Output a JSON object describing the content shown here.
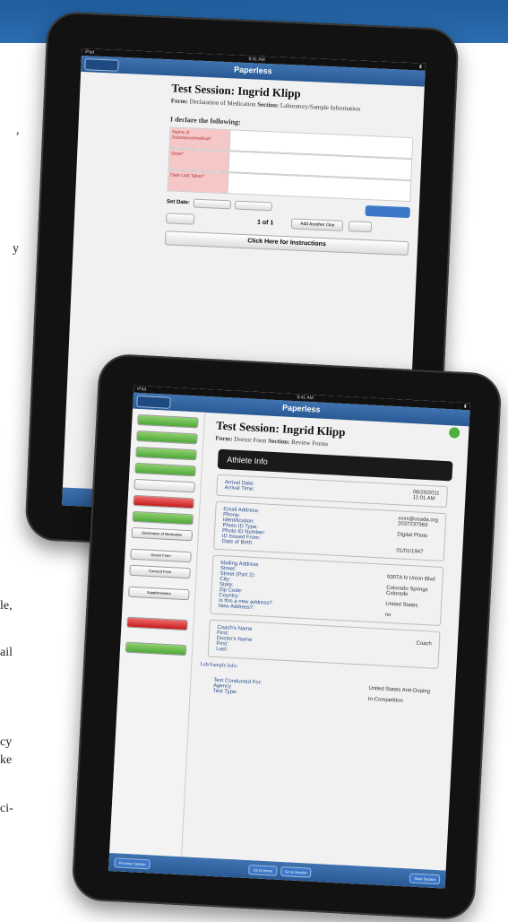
{
  "page": {
    "text_fragments": [
      ",",
      "y",
      "le,",
      "ail",
      "cy",
      "ke",
      "ci-"
    ]
  },
  "back_tablet": {
    "status_time": "9:41 AM",
    "app_title": "Paperless",
    "session_title": "Test Session: Ingrid Klipp",
    "form_label": "Form:",
    "form_name": "Declaration of Medication",
    "section_label": "Section:",
    "section_name": "Laboratory/Sample Information",
    "declare_heading": "I declare the following:",
    "field1_label": "Name of Substance/method*",
    "field2_label": "Dose*",
    "field3_label": "Date Last Taken*",
    "list_date_label": "Set Date:",
    "pager": "1 of 1",
    "add_another": "Add Another One",
    "instructions": "Click Here for Instructions"
  },
  "front_tablet": {
    "app_title": "Paperless",
    "session_title": "Test Session: Ingrid Klipp",
    "form_label": "Form:",
    "form_name": "Doctor Form",
    "section_label": "Section:",
    "section_name": "Review Forms",
    "sidebar_items": [
      "Declaration of Medication",
      "Doctor Form",
      "Consent Form",
      "Supplementary"
    ],
    "header": "Athlete Info",
    "arrival": {
      "labels": [
        "Arrival Date:",
        "Arrival Time:"
      ],
      "values": [
        "06/20/2011",
        "11:01 AM"
      ]
    },
    "identity": {
      "labels": [
        "Email Address:",
        "Phone:",
        "Identification:",
        "Photo ID Type:",
        "Photo ID Number:",
        "ID Issued From:",
        "Date of Birth:"
      ],
      "values": [
        "xxxx@usada.org",
        "2037237963",
        "",
        "Digital Photo",
        "",
        "",
        "01/01/1947"
      ]
    },
    "address": {
      "labels": [
        "Mailing Address",
        "Street:",
        "Street (Part 2):",
        "City:",
        "State:",
        "Zip Code:",
        "Country:",
        "Is this a new address?",
        "New Address?:"
      ],
      "values": [
        "",
        "9307A N Union Blvd",
        "",
        "Colorado Springs",
        "Colorado",
        "",
        "United States",
        "",
        "no"
      ]
    },
    "coach": {
      "labels": [
        "Coach's Name",
        "First:",
        "Doctor's Name",
        "First:",
        "Last:"
      ],
      "values": [
        "",
        "Coach",
        "",
        "",
        ""
      ]
    },
    "lab_heading": "Lab/Sample Info:",
    "lab": {
      "labels": [
        "Test Conducted For:",
        "Agency",
        "Test Type:"
      ],
      "values": [
        "United States Anti-Doping",
        "",
        "In-Competition"
      ]
    },
    "bottom_buttons": [
      "Previous Section",
      "Go to Home",
      "Go to Section",
      "Save Section"
    ]
  }
}
